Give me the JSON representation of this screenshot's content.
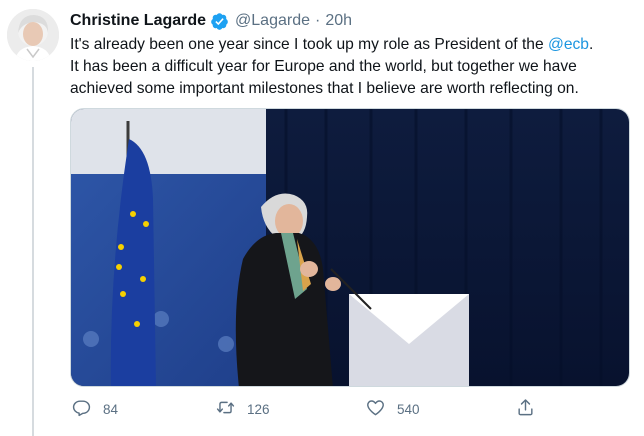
{
  "author": {
    "name": "Christine Lagarde",
    "handle": "@Lagarde",
    "separator": "·",
    "time": "20h",
    "verified": true
  },
  "tweet": {
    "line1_prefix": "It's already been one year since I took up my role as President of the ",
    "mention": "@ecb",
    "line1_suffix": ".",
    "line2": "It has been a difficult year for Europe and the world, but together we have",
    "line3": "achieved some important milestones that I believe are worth reflecting on."
  },
  "actions": {
    "replies": "84",
    "retweets": "126",
    "likes": "540"
  },
  "icons": {
    "reply": "reply-icon",
    "retweet": "retweet-icon",
    "like": "heart-icon",
    "share": "share-icon",
    "verified": "verified-badge-icon"
  },
  "colors": {
    "accent": "#1b95e0",
    "verified": "#1da1f2",
    "secondary_text": "#5b7083"
  }
}
